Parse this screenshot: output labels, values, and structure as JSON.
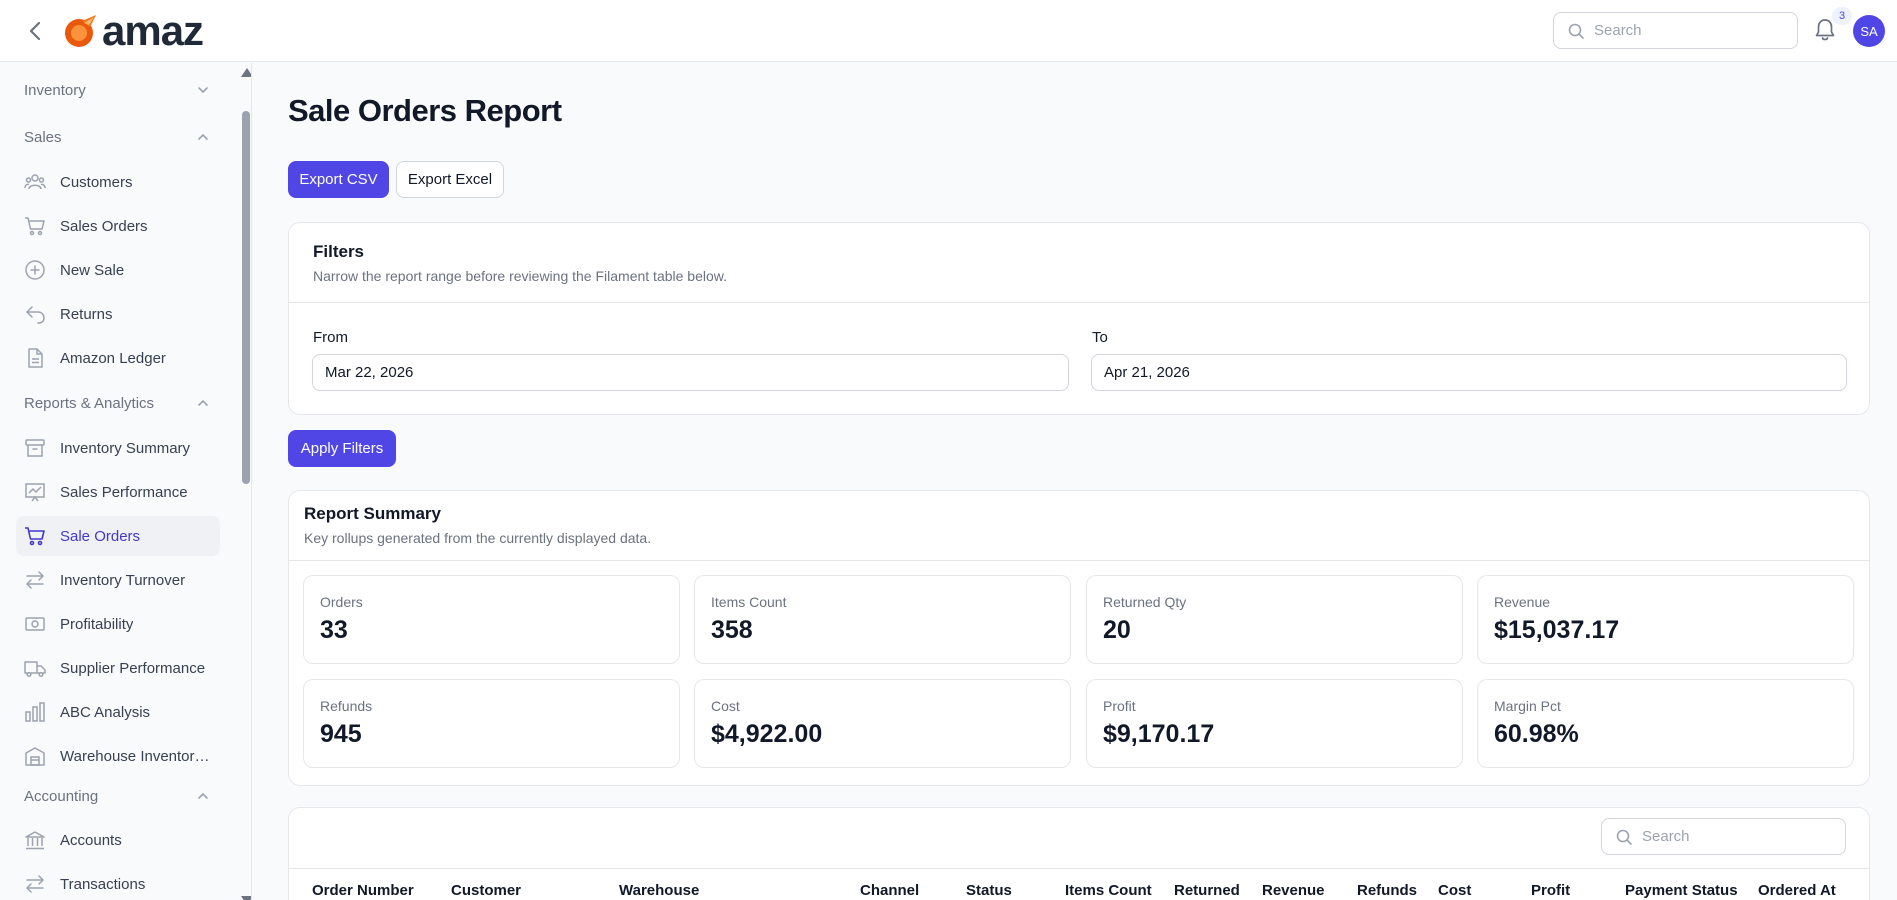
{
  "app": {
    "logo_text": "amaz",
    "brand_color": "#4f46e5"
  },
  "topbar": {
    "search_placeholder": "Search",
    "notification_count": "3",
    "avatar_initials": "SA"
  },
  "sidebar": {
    "groups": {
      "inventory": "Inventory",
      "sales": "Sales",
      "reports": "Reports & Analytics",
      "accounting": "Accounting"
    },
    "sales_items": [
      {
        "label": "Customers",
        "icon": "users-icon"
      },
      {
        "label": "Sales Orders",
        "icon": "cart-icon"
      },
      {
        "label": "New Sale",
        "icon": "plus-circle-icon"
      },
      {
        "label": "Returns",
        "icon": "return-arrow-icon"
      },
      {
        "label": "Amazon Ledger",
        "icon": "document-icon"
      }
    ],
    "report_items": [
      {
        "label": "Inventory Summary",
        "icon": "archive-box-icon"
      },
      {
        "label": "Sales Performance",
        "icon": "chart-presentation-icon"
      },
      {
        "label": "Sale Orders",
        "icon": "cart-icon",
        "active": true
      },
      {
        "label": "Inventory Turnover",
        "icon": "arrows-exchange-icon"
      },
      {
        "label": "Profitability",
        "icon": "cash-icon"
      },
      {
        "label": "Supplier Performance",
        "icon": "truck-icon"
      },
      {
        "label": "ABC Analysis",
        "icon": "bar-chart-icon"
      },
      {
        "label": "Warehouse Inventor…",
        "icon": "warehouse-icon"
      }
    ],
    "accounting_items": [
      {
        "label": "Accounts",
        "icon": "bank-icon"
      },
      {
        "label": "Transactions",
        "icon": "arrows-exchange-icon"
      }
    ]
  },
  "page": {
    "title": "Sale Orders Report",
    "export_csv": "Export CSV",
    "export_excel": "Export Excel",
    "apply_filters": "Apply Filters"
  },
  "filters": {
    "title": "Filters",
    "description": "Narrow the report range before reviewing the Filament table below.",
    "from_label": "From",
    "from_value": "Mar 22, 2026",
    "to_label": "To",
    "to_value": "Apr 21, 2026"
  },
  "summary": {
    "title": "Report Summary",
    "description": "Key rollups generated from the currently displayed data.",
    "stats": [
      {
        "label": "Orders",
        "value": "33"
      },
      {
        "label": "Items Count",
        "value": "358"
      },
      {
        "label": "Returned Qty",
        "value": "20"
      },
      {
        "label": "Revenue",
        "value": "$15,037.17"
      },
      {
        "label": "Refunds",
        "value": "945"
      },
      {
        "label": "Cost",
        "value": "$4,922.00"
      },
      {
        "label": "Profit",
        "value": "$9,170.17"
      },
      {
        "label": "Margin Pct",
        "value": "60.98%"
      }
    ]
  },
  "table": {
    "search_placeholder": "Search",
    "columns": [
      "Order Number",
      "Customer",
      "Warehouse",
      "Channel",
      "Status",
      "Items Count",
      "Returned",
      "Revenue",
      "Refunds",
      "Cost",
      "Profit",
      "Payment Status",
      "Ordered At"
    ]
  }
}
